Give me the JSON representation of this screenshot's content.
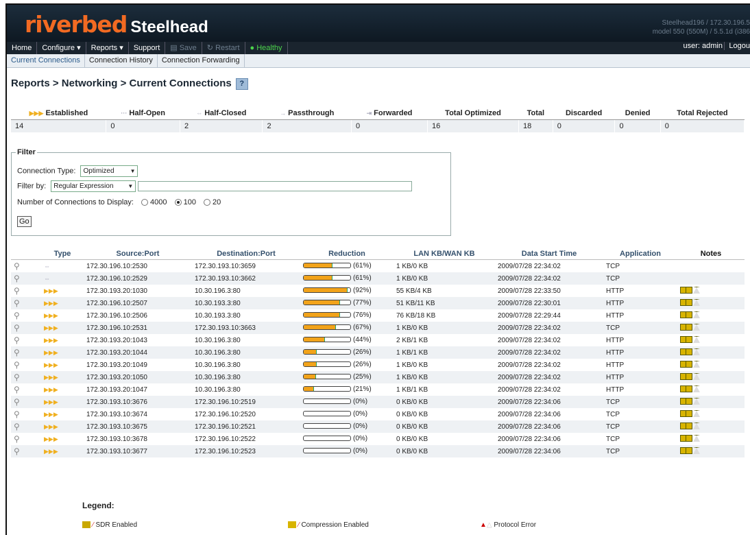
{
  "header": {
    "brand": "riverbed",
    "product": "Steelhead",
    "device_line1": "Steelhead196 / 172.30.196.5",
    "device_line2": "model 550 (550M) / 5.5.1d (i386"
  },
  "menu": {
    "home": "Home",
    "configure": "Configure ▾",
    "reports": "Reports ▾",
    "support": "Support",
    "save": "Save",
    "restart": "Restart",
    "status": "Healthy",
    "user": "user: admin",
    "logout": "Logou"
  },
  "subtabs": [
    "Current Connections",
    "Connection History",
    "Connection Forwarding"
  ],
  "page_title": "Reports > Networking > Current Connections",
  "help_label": "?",
  "summary": {
    "headers": [
      "Established",
      "Half-Open",
      "Half-Closed",
      "Passthrough",
      "Forwarded",
      "Total Optimized",
      "Total",
      "Discarded",
      "Denied",
      "Total Rejected"
    ],
    "values": [
      "14",
      "0",
      "2",
      "2",
      "0",
      "16",
      "18",
      "0",
      "0",
      "0"
    ]
  },
  "filter": {
    "legend": "Filter",
    "conn_type_label": "Connection Type:",
    "conn_type_value": "Optimized",
    "filter_by_label": "Filter by:",
    "filter_by_value": "Regular Expression",
    "filter_text": "",
    "num_label": "Number of Connections to Display:",
    "options": [
      "4000",
      "100",
      "20"
    ],
    "selected": "100",
    "go_label": "Go"
  },
  "table": {
    "headers": [
      "Type",
      "Source:Port",
      "Destination:Port",
      "Reduction",
      "LAN KB/WAN KB",
      "Data Start Time",
      "Application",
      "Notes"
    ],
    "rows": [
      {
        "type": "half-closed",
        "src": "172.30.196.10:2530",
        "dst": "172.30.193.10:3659",
        "red": 61,
        "red_label": "(61%)",
        "lanwan": "1 KB/0 KB",
        "start": "2009/07/28 22:34:02",
        "app": "TCP",
        "notes": false
      },
      {
        "type": "half-closed",
        "src": "172.30.196.10:2529",
        "dst": "172.30.193.10:3662",
        "red": 61,
        "red_label": "(61%)",
        "lanwan": "1 KB/0 KB",
        "start": "2009/07/28 22:34:02",
        "app": "TCP",
        "notes": false
      },
      {
        "type": "established",
        "src": "172.30.193.20:1030",
        "dst": "10.30.196.3:80",
        "red": 92,
        "red_label": "(92%)",
        "lanwan": "55 KB/4 KB",
        "start": "2009/07/28 22:33:50",
        "app": "HTTP",
        "notes": true
      },
      {
        "type": "established",
        "src": "172.30.196.10:2507",
        "dst": "10.30.193.3:80",
        "red": 77,
        "red_label": "(77%)",
        "lanwan": "51 KB/11 KB",
        "start": "2009/07/28 22:30:01",
        "app": "HTTP",
        "notes": true
      },
      {
        "type": "established",
        "src": "172.30.196.10:2506",
        "dst": "10.30.193.3:80",
        "red": 76,
        "red_label": "(76%)",
        "lanwan": "76 KB/18 KB",
        "start": "2009/07/28 22:29:44",
        "app": "HTTP",
        "notes": true
      },
      {
        "type": "established",
        "src": "172.30.196.10:2531",
        "dst": "172.30.193.10:3663",
        "red": 67,
        "red_label": "(67%)",
        "lanwan": "1 KB/0 KB",
        "start": "2009/07/28 22:34:02",
        "app": "TCP",
        "notes": true
      },
      {
        "type": "established",
        "src": "172.30.193.20:1043",
        "dst": "10.30.196.3:80",
        "red": 44,
        "red_label": "(44%)",
        "lanwan": "2 KB/1 KB",
        "start": "2009/07/28 22:34:02",
        "app": "HTTP",
        "notes": true
      },
      {
        "type": "established",
        "src": "172.30.193.20:1044",
        "dst": "10.30.196.3:80",
        "red": 26,
        "red_label": "(26%)",
        "lanwan": "1 KB/1 KB",
        "start": "2009/07/28 22:34:02",
        "app": "HTTP",
        "notes": true
      },
      {
        "type": "established",
        "src": "172.30.193.20:1049",
        "dst": "10.30.196.3:80",
        "red": 26,
        "red_label": "(26%)",
        "lanwan": "1 KB/0 KB",
        "start": "2009/07/28 22:34:02",
        "app": "HTTP",
        "notes": true
      },
      {
        "type": "established",
        "src": "172.30.193.20:1050",
        "dst": "10.30.196.3:80",
        "red": 25,
        "red_label": "(25%)",
        "lanwan": "1 KB/0 KB",
        "start": "2009/07/28 22:34:02",
        "app": "HTTP",
        "notes": true
      },
      {
        "type": "established",
        "src": "172.30.193.20:1047",
        "dst": "10.30.196.3:80",
        "red": 21,
        "red_label": "(21%)",
        "lanwan": "1 KB/1 KB",
        "start": "2009/07/28 22:34:02",
        "app": "HTTP",
        "notes": true
      },
      {
        "type": "established",
        "src": "172.30.193.10:3676",
        "dst": "172.30.196.10:2519",
        "red": 0,
        "red_label": "(0%)",
        "lanwan": "0 KB/0 KB",
        "start": "2009/07/28 22:34:06",
        "app": "TCP",
        "notes": true
      },
      {
        "type": "established",
        "src": "172.30.193.10:3674",
        "dst": "172.30.196.10:2520",
        "red": 0,
        "red_label": "(0%)",
        "lanwan": "0 KB/0 KB",
        "start": "2009/07/28 22:34:06",
        "app": "TCP",
        "notes": true
      },
      {
        "type": "established",
        "src": "172.30.193.10:3675",
        "dst": "172.30.196.10:2521",
        "red": 0,
        "red_label": "(0%)",
        "lanwan": "0 KB/0 KB",
        "start": "2009/07/28 22:34:06",
        "app": "TCP",
        "notes": true
      },
      {
        "type": "established",
        "src": "172.30.193.10:3678",
        "dst": "172.30.196.10:2522",
        "red": 0,
        "red_label": "(0%)",
        "lanwan": "0 KB/0 KB",
        "start": "2009/07/28 22:34:06",
        "app": "TCP",
        "notes": true
      },
      {
        "type": "established",
        "src": "172.30.193.10:3677",
        "dst": "172.30.196.10:2523",
        "red": 0,
        "red_label": "(0%)",
        "lanwan": "0 KB/0 KB",
        "start": "2009/07/28 22:34:06",
        "app": "TCP",
        "notes": true
      }
    ]
  },
  "legend": {
    "title": "Legend:",
    "sdr": "SDR Enabled",
    "compression": "Compression Enabled",
    "protocol_error": "Protocol Error"
  },
  "colors": {
    "accent": "#f26a22",
    "bar_fill": "#f2a31a",
    "header_bg": "#1c2d3c",
    "healthy": "#4cd44c"
  }
}
